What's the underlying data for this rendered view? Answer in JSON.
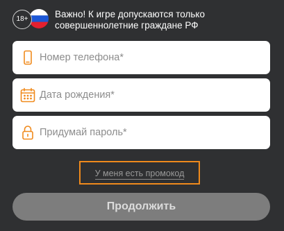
{
  "notice": {
    "age_badge": "18+",
    "flag_icon": "russia-flag-icon",
    "text": "Важно! К игре допускаются только совершеннолетние граждане РФ"
  },
  "form": {
    "phone": {
      "placeholder": "Номер телефона*",
      "icon": "phone-icon",
      "value": ""
    },
    "birthdate": {
      "placeholder": "Дата рождения*",
      "icon": "calendar-icon",
      "value": ""
    },
    "password": {
      "placeholder": "Придумай пароль*",
      "icon": "lock-icon",
      "value": ""
    }
  },
  "promo": {
    "label": "У меня есть промокод"
  },
  "continue_button": {
    "label": "Продолжить"
  },
  "colors": {
    "background": "#2f3032",
    "accent": "#f08a1c",
    "field_bg": "#ffffff",
    "button_disabled": "#7d7d7d"
  }
}
